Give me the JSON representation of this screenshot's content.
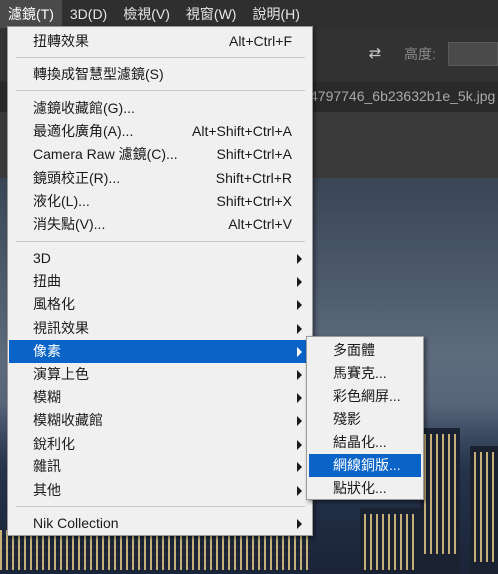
{
  "menubar": {
    "items": [
      {
        "label": "濾鏡(T)",
        "active": true
      },
      {
        "label": "3D(D)"
      },
      {
        "label": "檢視(V)"
      },
      {
        "label": "視窗(W)"
      },
      {
        "label": "說明(H)"
      }
    ]
  },
  "options_bar": {
    "height_label": "高度:",
    "swap_icon": "swap-arrows-icon"
  },
  "document_tab": {
    "title": "4797746_6b23632b1e_5k.jpg"
  },
  "filter_menu": {
    "items": [
      {
        "label": "扭轉效果",
        "shortcut": "Alt+Ctrl+F"
      },
      {
        "label": "轉換成智慧型濾鏡(S)",
        "shortcut": ""
      },
      {
        "label": "濾鏡收藏館(G)...",
        "shortcut": ""
      },
      {
        "label": "最適化廣角(A)...",
        "shortcut": "Alt+Shift+Ctrl+A"
      },
      {
        "label": "Camera Raw 濾鏡(C)...",
        "shortcut": "Shift+Ctrl+A"
      },
      {
        "label": "鏡頭校正(R)...",
        "shortcut": "Shift+Ctrl+R"
      },
      {
        "label": "液化(L)...",
        "shortcut": "Shift+Ctrl+X"
      },
      {
        "label": "消失點(V)...",
        "shortcut": "Alt+Ctrl+V"
      },
      {
        "label": "3D",
        "submenu": true
      },
      {
        "label": "扭曲",
        "submenu": true
      },
      {
        "label": "風格化",
        "submenu": true
      },
      {
        "label": "視訊效果",
        "submenu": true
      },
      {
        "label": "像素",
        "submenu": true,
        "highlighted": true
      },
      {
        "label": "演算上色",
        "submenu": true
      },
      {
        "label": "模糊",
        "submenu": true
      },
      {
        "label": "模糊收藏館",
        "submenu": true
      },
      {
        "label": "銳利化",
        "submenu": true
      },
      {
        "label": "雜訊",
        "submenu": true
      },
      {
        "label": "其他",
        "submenu": true
      },
      {
        "label": "Nik Collection",
        "submenu": true
      }
    ]
  },
  "pixelate_submenu": {
    "items": [
      {
        "label": "多面體"
      },
      {
        "label": "馬賽克..."
      },
      {
        "label": "彩色網屏..."
      },
      {
        "label": "殘影"
      },
      {
        "label": "結晶化..."
      },
      {
        "label": "網線銅版...",
        "highlighted": true
      },
      {
        "label": "點狀化..."
      }
    ]
  },
  "colors": {
    "highlight": "#0a64c8",
    "menu_bg": "#f0f0f0",
    "app_bg": "#2f2f2f"
  }
}
